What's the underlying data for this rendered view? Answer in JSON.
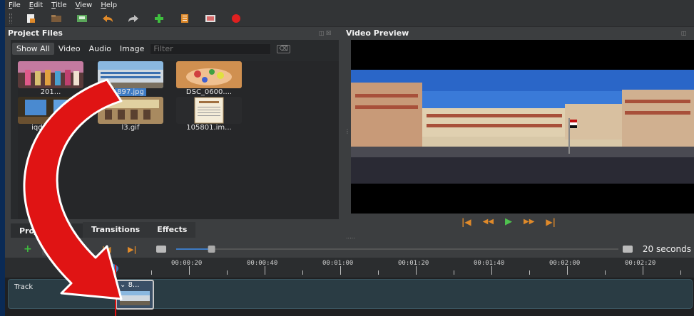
{
  "menu": [
    "File",
    "Edit",
    "Title",
    "View",
    "Help"
  ],
  "toolbar": {
    "buttons": [
      "new-project-icon",
      "open-project-icon",
      "save-project-icon",
      "undo-icon",
      "redo-icon",
      "import-files-icon",
      "profile-icon",
      "fullscreen-icon",
      "export-video-icon"
    ],
    "colors": {
      "new": "#e08a2a",
      "open": "#7a5a3a",
      "save": "#5aa65a",
      "undo": "#e08a2a",
      "redo": "#bdbdbd",
      "add": "#3fbf3f",
      "profile": "#e08a2a",
      "fullscreen": "#d86a6a",
      "export": "#e02020"
    }
  },
  "project_files": {
    "title": "Project Files",
    "filters": [
      "Show All",
      "Video",
      "Audio",
      "Image"
    ],
    "active_filter": "Show All",
    "filter_placeholder": "Filter",
    "items": [
      {
        "label": "201...",
        "kind": "photo-people"
      },
      {
        "label": "897.jpg",
        "kind": "photo-building",
        "selected": true
      },
      {
        "label": "DSC_0600....",
        "kind": "photo-cake"
      },
      {
        "label": "iqdefault...",
        "kind": "photo-room"
      },
      {
        "label": "l3.gif",
        "kind": "photo-class"
      },
      {
        "label": "105801.im...",
        "kind": "certificate"
      }
    ]
  },
  "video_preview": {
    "title": "Video Preview"
  },
  "bottom_tabs": [
    "Project Files",
    "Transitions",
    "Effects"
  ],
  "active_bottom_tab": "Project Files",
  "timeline": {
    "zoom_label": "20 seconds",
    "slider_level": 0.08,
    "playhead_time_label": ":00:0",
    "ruler_labels": [
      "00:00:20",
      "00:00:40",
      "00:01:00",
      "00:01:20",
      "00:01:40",
      "00:02:00",
      "00:02:20"
    ],
    "track_name": "Track",
    "clip_label": "8...",
    "colors": {
      "playhead": "#e01010",
      "track": "#2a3c44",
      "slider": "#3d7bc4"
    }
  },
  "overlay": {
    "arrow_color": "#e01414",
    "arrow_outline": "#ffffff"
  }
}
